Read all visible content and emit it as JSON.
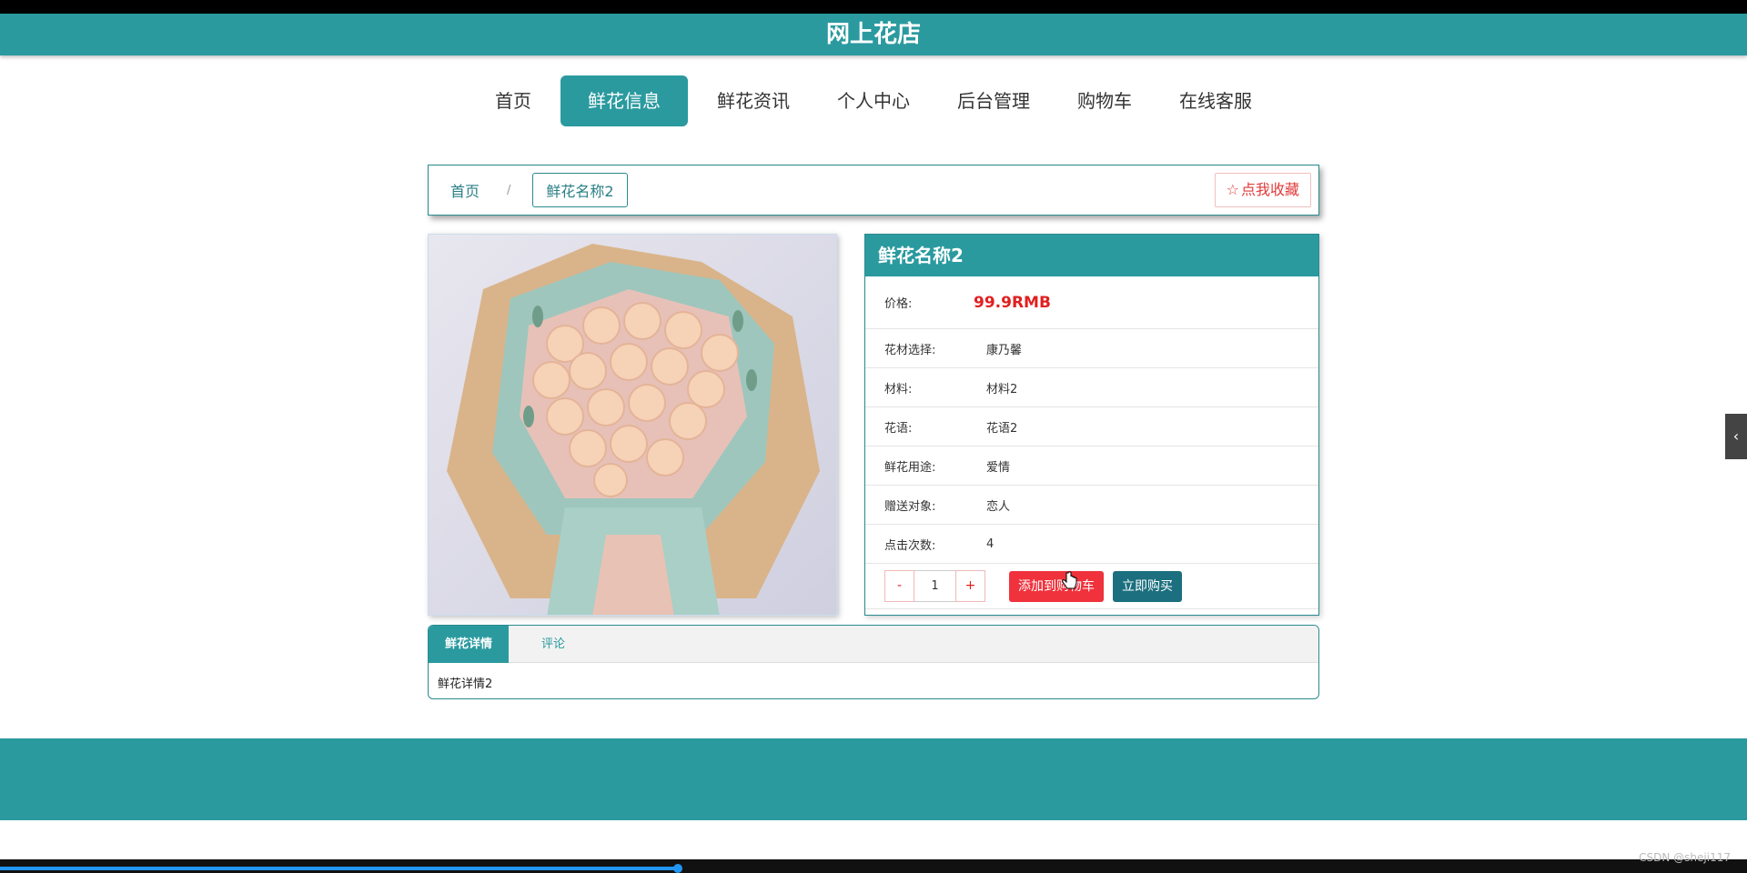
{
  "header": {
    "title": "网上花店"
  },
  "nav": {
    "items": [
      {
        "label": "首页"
      },
      {
        "label": "鲜花信息"
      },
      {
        "label": "鲜花资讯"
      },
      {
        "label": "个人中心"
      },
      {
        "label": "后台管理"
      },
      {
        "label": "购物车"
      },
      {
        "label": "在线客服"
      }
    ],
    "active": "鲜花信息"
  },
  "breadcrumb": {
    "home": "首页",
    "separator": "/",
    "current": "鲜花名称2",
    "favorite_label": "点我收藏",
    "favorite_icon": "star-outline-icon"
  },
  "product": {
    "name": "鲜花名称2",
    "price_label": "价格:",
    "price": "99.9RMB",
    "fields": [
      {
        "label": "花材选择:",
        "value": "康乃馨"
      },
      {
        "label": "材料:",
        "value": "材料2"
      },
      {
        "label": "花语:",
        "value": "花语2"
      },
      {
        "label": "鲜花用途:",
        "value": "爱情"
      },
      {
        "label": "赠送对象:",
        "value": "恋人"
      },
      {
        "label": "点击次数:",
        "value": "4"
      }
    ],
    "quantity": "1",
    "minus": "-",
    "plus": "+",
    "add_to_cart": "添加到购物车",
    "buy_now": "立即购买"
  },
  "tabs": {
    "items": [
      {
        "label": "鲜花详情"
      },
      {
        "label": "评论"
      }
    ],
    "active": "鲜花详情",
    "content": "鲜花详情2"
  },
  "side_toggle": "‹",
  "watermark": "CSDN @sheji117",
  "colors": {
    "primary": "#2a9a9f",
    "danger": "#f0323c",
    "buy": "#1b6f7e",
    "price": "#e02020"
  },
  "video_progress": 0.388
}
